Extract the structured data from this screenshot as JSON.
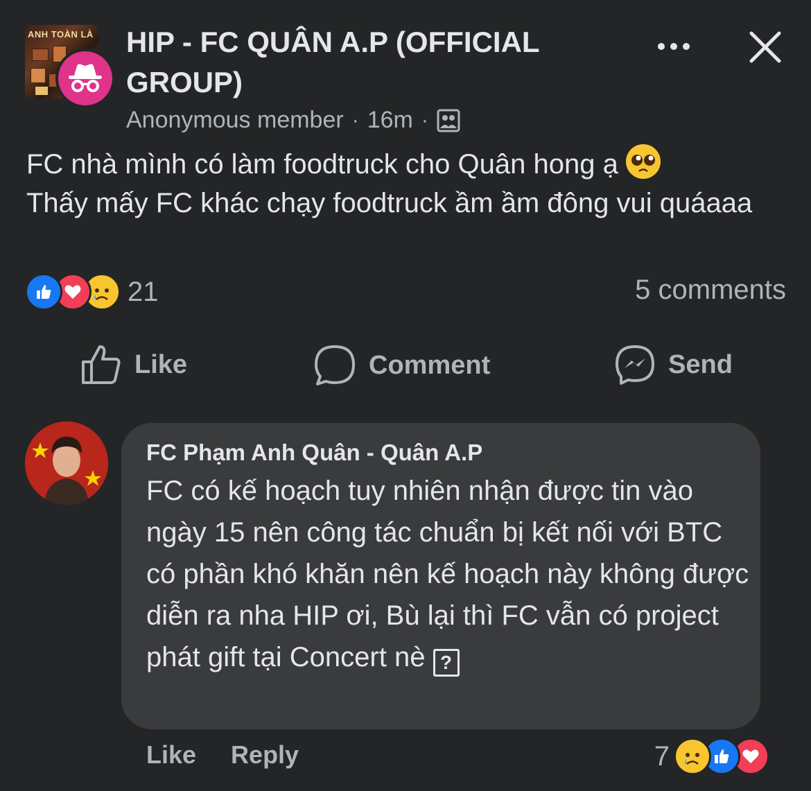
{
  "header": {
    "group_thumb_text": "ANH TOÀN LÀ",
    "group_name": "HIP - FC QUÂN A.P (OFFICIAL GROUP)",
    "author": "Anonymous member",
    "time": "16m",
    "separator": "·",
    "audience_icon": "group-audience-icon",
    "more_icon": "more-dots-icon",
    "close_icon": "close-icon"
  },
  "post": {
    "line1": "FC nhà mình có làm foodtruck cho Quân hong ạ",
    "line2": "Thấy mấy FC khác chạy foodtruck ầm ầm đông vui quáaaa",
    "emoji": "pleading-face-emoji"
  },
  "stats": {
    "reactions": [
      "like",
      "love",
      "sad"
    ],
    "reaction_count": "21",
    "comments": "5 comments"
  },
  "actions": {
    "like": "Like",
    "comment": "Comment",
    "send": "Send"
  },
  "comment": {
    "author": "FC Phạm Anh Quân - Quân A.P",
    "text": "FC có kế hoạch tuy nhiên nhận được tin vào ngày 15 nên công tác chuẩn bị kết nối với BTC có phần khó khăn nên kế hoạch này không được diễn ra nha HIP ơi, Bù lại thì FC vẫn có project phát gift tại Concert nè",
    "unknown_glyph": "?",
    "like": "Like",
    "reply": "Reply",
    "reaction_count": "7",
    "reactions": [
      "sad",
      "like",
      "love"
    ]
  },
  "colors": {
    "background": "#242526",
    "bubble": "#3a3b3c",
    "text_primary": "#e4e6eb",
    "text_secondary": "#b0b3b8",
    "like_blue": "#1877f2",
    "love_red": "#f33e58",
    "anon_pink": "#e0338a"
  }
}
